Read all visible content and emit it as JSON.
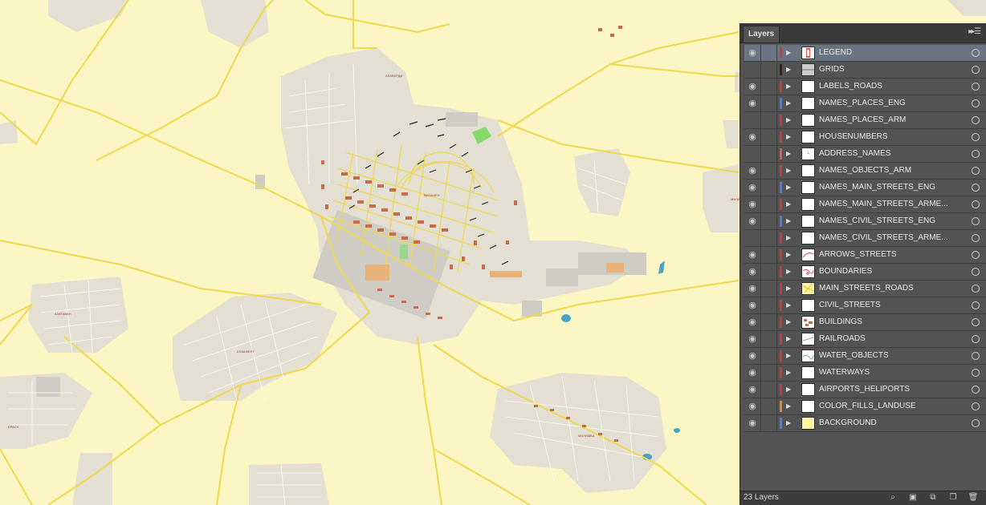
{
  "map": {
    "label_a": "ВАЗАШЕН",
    "label_b": "АЛАВЕРДИ",
    "label_c": "АЛАШКЕРТ",
    "label_d": "МАЛИШКА",
    "label_e": "АЗАТАВАН",
    "label_f": "ЕРАСХ",
    "label_g": "МАЛИ",
    "colors": {
      "background": "#fbf6c4",
      "road": "#f0d84a",
      "urban": "#e0dcd0",
      "building": "#c96a48",
      "water": "#4aa3c6",
      "park": "#86d96a"
    }
  },
  "panel": {
    "tab": "Layers",
    "layer_count": "23 Layers",
    "layers": [
      {
        "name": "LEGEND",
        "visible": true,
        "color": "#c63b3b",
        "thumb": "legend",
        "selected": true
      },
      {
        "name": "GRIDS",
        "visible": false,
        "color": "#4a1b1b",
        "thumb": "grid"
      },
      {
        "name": "LABELS_ROADS",
        "visible": true,
        "color": "#c63b3b",
        "thumb": "blank"
      },
      {
        "name": "NAMES_PLACES_ENG",
        "visible": true,
        "color": "#4f7be0",
        "thumb": "blank"
      },
      {
        "name": "NAMES_PLACES_ARM",
        "visible": false,
        "color": "#c63b3b",
        "thumb": "blank"
      },
      {
        "name": "HOUSENUMBERS",
        "visible": true,
        "color": "#c63b3b",
        "thumb": "blank"
      },
      {
        "name": "ADDRESS_NAMES",
        "visible": false,
        "color": "#e05a5a",
        "thumb": "dots"
      },
      {
        "name": "NAMES_OBJECTS_ARM",
        "visible": true,
        "color": "#c63b3b",
        "thumb": "blank"
      },
      {
        "name": "NAMES_MAIN_STREETS_ENG",
        "visible": true,
        "color": "#4f7be0",
        "thumb": "blank"
      },
      {
        "name": "NAMES_MAIN_STREETS_ARME...",
        "visible": true,
        "color": "#c63b3b",
        "thumb": "blank"
      },
      {
        "name": "NAMES_CIVIL_STREETS_ENG",
        "visible": true,
        "color": "#4f7be0",
        "thumb": "blank"
      },
      {
        "name": "NAMES_CIVIL_STREETS_ARME...",
        "visible": false,
        "color": "#c63b3b",
        "thumb": "blank"
      },
      {
        "name": "ARROWS_STREETS",
        "visible": true,
        "color": "#c63b3b",
        "thumb": "arrows"
      },
      {
        "name": "BOUNDARIES",
        "visible": true,
        "color": "#c63b3b",
        "thumb": "boundaries"
      },
      {
        "name": "MAIN_STREETS_ROADS",
        "visible": true,
        "color": "#c63b3b",
        "thumb": "roads"
      },
      {
        "name": "CIVIL_STREETS",
        "visible": true,
        "color": "#c63b3b",
        "thumb": "blank"
      },
      {
        "name": "BUILDINGS",
        "visible": true,
        "color": "#c63b3b",
        "thumb": "buildings"
      },
      {
        "name": "RAILROADS",
        "visible": true,
        "color": "#c63b3b",
        "thumb": "rail"
      },
      {
        "name": "WATER_OBJECTS",
        "visible": true,
        "color": "#c63b3b",
        "thumb": "water"
      },
      {
        "name": "WATERWAYS",
        "visible": true,
        "color": "#c63b3b",
        "thumb": "blank"
      },
      {
        "name": "AIRPORTS_HELIPORTS",
        "visible": true,
        "color": "#c63b3b",
        "thumb": "blank"
      },
      {
        "name": "COLOR_FILLS_LANDUSE",
        "visible": true,
        "color": "#e08a2a",
        "thumb": "blank"
      },
      {
        "name": "BACKGROUND",
        "visible": true,
        "color": "#4f7be0",
        "thumb": "background"
      }
    ]
  }
}
